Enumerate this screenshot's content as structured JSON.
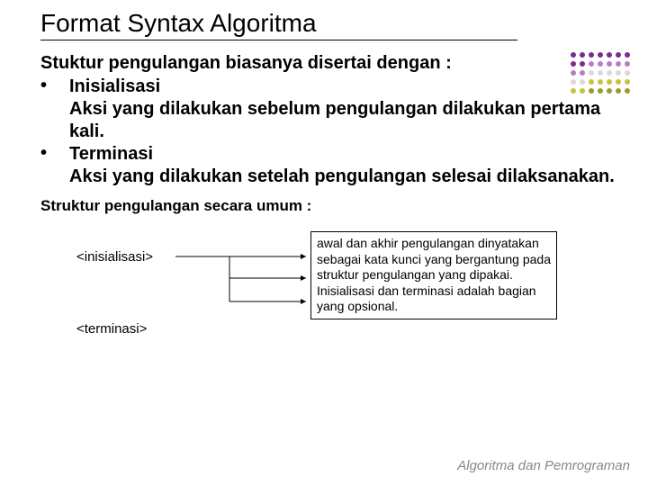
{
  "title": "Format Syntax Algoritma",
  "intro": "Stuktur pengulangan biasanya disertai dengan :",
  "bullets": [
    {
      "head": "Inisialisasi",
      "desc": "Aksi yang dilakukan sebelum pengulangan dilakukan pertama kali."
    },
    {
      "head": "Terminasi",
      "desc": "Aksi yang dilakukan setelah pengulangan selesai dilaksanakan."
    }
  ],
  "sub": "Struktur pengulangan secara umum :",
  "tags": {
    "init": "<inisialisasi>",
    "term": "<terminasi>"
  },
  "box": "awal dan akhir pengulangan dinyatakan sebagai kata kunci yang bergantung pada struktur pengulangan yang dipakai. Inisialisasi dan terminasi adalah bagian yang opsional.",
  "footer": "Algoritma dan Pemrograman",
  "dot_colors": [
    "#7b2d8e",
    "#7b2d8e",
    "#7b2d8e",
    "#7b2d8e",
    "#7b2d8e",
    "#7b2d8e",
    "#7b2d8e",
    "#7b2d8e",
    "#7b2d8e",
    "#b87dc9",
    "#b87dc9",
    "#b87dc9",
    "#b87dc9",
    "#b87dc9",
    "#b87dc9",
    "#b87dc9",
    "#d9d9d9",
    "#d9d9d9",
    "#d9d9d9",
    "#d9d9d9",
    "#d9d9d9",
    "#d9d9d9",
    "#d9d9d9",
    "#c7c23a",
    "#c7c23a",
    "#c7c23a",
    "#c7c23a",
    "#c7c23a",
    "#c7c23a",
    "#c7c23a",
    "#9b9b2a",
    "#9b9b2a",
    "#9b9b2a",
    "#9b9b2a",
    "#9b9b2a"
  ]
}
